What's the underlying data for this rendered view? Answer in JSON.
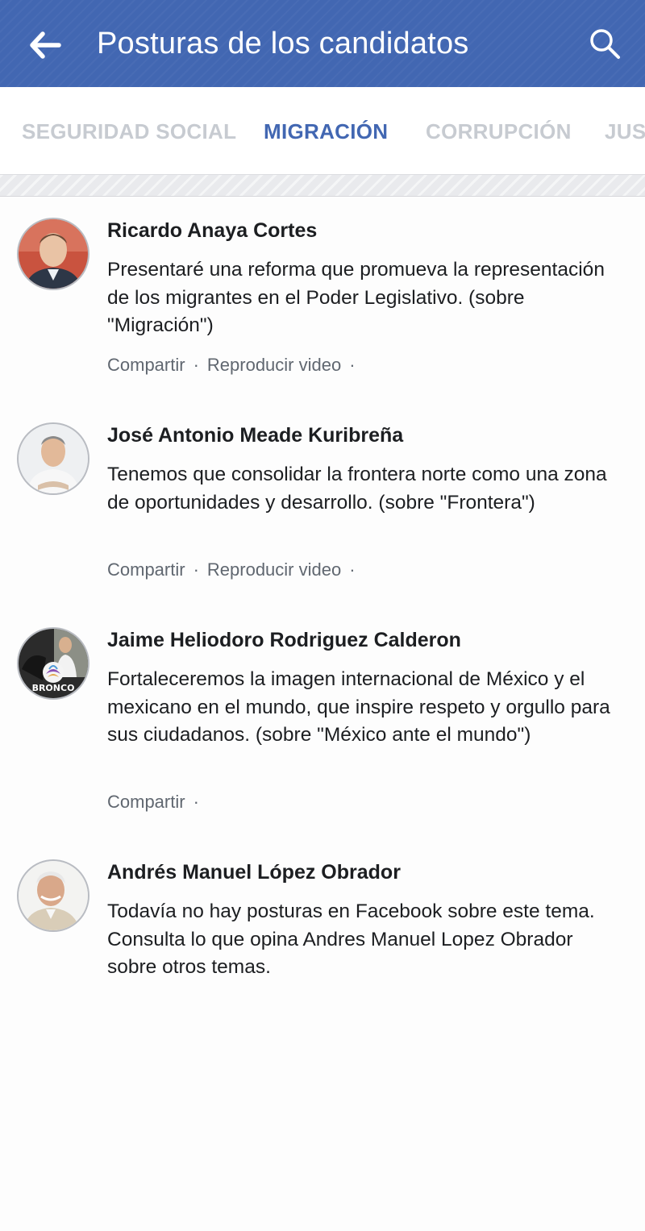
{
  "header": {
    "title": "Posturas de los candidatos",
    "back_icon": "arrow-left-icon",
    "search_icon": "search-icon",
    "bar_color": "#4267b2"
  },
  "tabs": [
    {
      "label": "SEGURIDAD SOCIAL",
      "active": false
    },
    {
      "label": "MIGRACIÓN",
      "active": true
    },
    {
      "label": "CORRUPCIÓN",
      "active": false
    },
    {
      "label": "JUS",
      "active": false
    }
  ],
  "posts": [
    {
      "name": "Ricardo Anaya Cortes",
      "text": "Presentaré una reforma que promueva la representación de los migrantes en el Poder Legislativo. (sobre \"Migración\")",
      "actions": [
        "Compartir",
        "Reproducir video"
      ]
    },
    {
      "name": "José Antonio Meade Kuribreña",
      "text": "Tenemos que consolidar la frontera norte como una zona de oportunidades y desarrollo. (sobre \"Frontera\")",
      "actions": [
        "Compartir",
        "Reproducir video"
      ]
    },
    {
      "name": "Jaime Heliodoro Rodriguez Calderon",
      "text": "Fortaleceremos la imagen internacional de México y el mexicano en el mundo, que inspire respeto y orgullo para sus ciudadanos. (sobre \"México ante el mundo\")",
      "actions": [
        "Compartir"
      ],
      "avatar_badge": "BRONCO"
    },
    {
      "name": "Andrés Manuel López Obrador",
      "text": "Todavía no hay posturas en Facebook sobre este tema. Consulta lo que opina Andres Manuel Lopez Obrador sobre otros temas.",
      "actions": []
    }
  ]
}
